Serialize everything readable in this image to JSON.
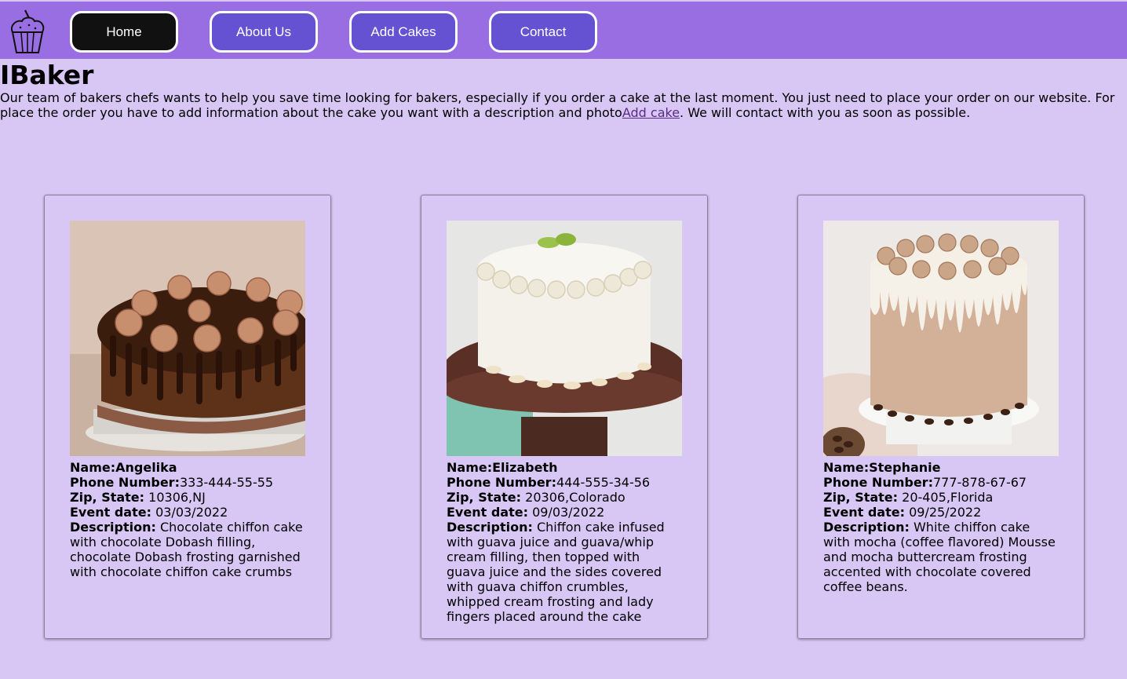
{
  "nav": {
    "logo_icon": "cupcake-icon",
    "items": [
      "Home",
      "About Us",
      "Add Cakes",
      "Contact"
    ],
    "active": "Home"
  },
  "header": {
    "title": "IBaker",
    "intro_line1": "Our team of bakers chefs wants to help you save time looking for bakers, especially if you order a cake at the last moment. You just need to place your order on our website. For",
    "intro_line2_pre": "place the order you have to add information about the cake you want with a description and photo",
    "intro_link": "Add cake",
    "intro_line2_post": ". We will contact with you as soon as possible."
  },
  "labels": {
    "name": "Name:",
    "phone": "Phone Number:",
    "zip": "Zip, State:",
    "event": "Event date:",
    "description": "Description:"
  },
  "cards": [
    {
      "image_icon": "chocolate-cake-photo",
      "name": "Angelika",
      "phone": "333-444-55-55",
      "zip_state": "10306,NJ",
      "event_date": "03/03/2022",
      "description_lines": [
        "Chocolate chiffon cake",
        "with chocolate Dobash filling,",
        "chocolate Dobash frosting garnished",
        "with chocolate chiffon cake crumbs"
      ]
    },
    {
      "image_icon": "guava-cake-photo",
      "name": "Elizabeth",
      "phone": "444-555-34-56",
      "zip_state": "20306,Colorado",
      "event_date": "09/03/2022",
      "description_lines": [
        "Chiffon cake infused",
        "with guava juice and guava/whip",
        "cream filling, then topped with",
        "guava juice and the sides covered",
        "with guava chiffon crumbles,",
        "whipped cream frosting and lady",
        "fingers placed around the cake"
      ]
    },
    {
      "image_icon": "mocha-cake-photo",
      "name": "Stephanie",
      "phone": "777-878-67-67",
      "zip_state": "20-405,Florida",
      "event_date": "09/25/2022",
      "description_lines": [
        "White chiffon cake",
        "with mocha (coffee flavored) Mousse",
        "and mocha buttercream frosting",
        "accented with chocolate covered",
        "coffee beans."
      ]
    }
  ],
  "colors": {
    "page_bg": "#d8c6f4",
    "topbar_bg": "#9a6ee3",
    "nav_button_bg": "#6552d2",
    "nav_active_bg": "#111111",
    "link": "#5b2a86"
  }
}
